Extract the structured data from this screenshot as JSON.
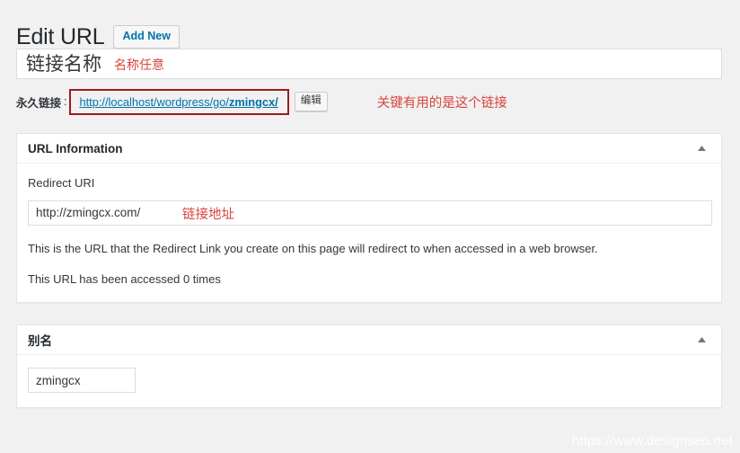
{
  "header": {
    "page_title": "Edit URL",
    "add_new_label": "Add New"
  },
  "title_field": {
    "value": "链接名称",
    "annotation": "名称任意",
    "annotation_color": "#d9453f"
  },
  "permalink": {
    "label": "永久链接",
    "separator": ":",
    "url_prefix": "http://localhost/wordpress/go/",
    "url_slug": "zmingcx/",
    "edit_button_label": "编辑",
    "annotation": "关键有用的是这个链接",
    "highlight_border_color": "#9b1c1c",
    "link_color": "#0073aa"
  },
  "url_information_panel": {
    "title": "URL Information",
    "toggle_icon": "chevron-up-icon",
    "redirect_uri_label": "Redirect URI",
    "redirect_uri_value": "http://zmingcx.com/",
    "redirect_uri_placeholder": "http://",
    "redirect_annotation": "链接地址",
    "help_text_1": "This is the URL that the Redirect Link you create on this page will redirect to when accessed in a web browser.",
    "help_text_2": "This URL has been accessed 0 times",
    "access_count": 0
  },
  "alias_panel": {
    "title": "别名",
    "toggle_icon": "chevron-up-icon",
    "alias_value": "zmingcx",
    "alias_placeholder": ""
  },
  "watermark": {
    "text": "https://www.designseo.net"
  }
}
